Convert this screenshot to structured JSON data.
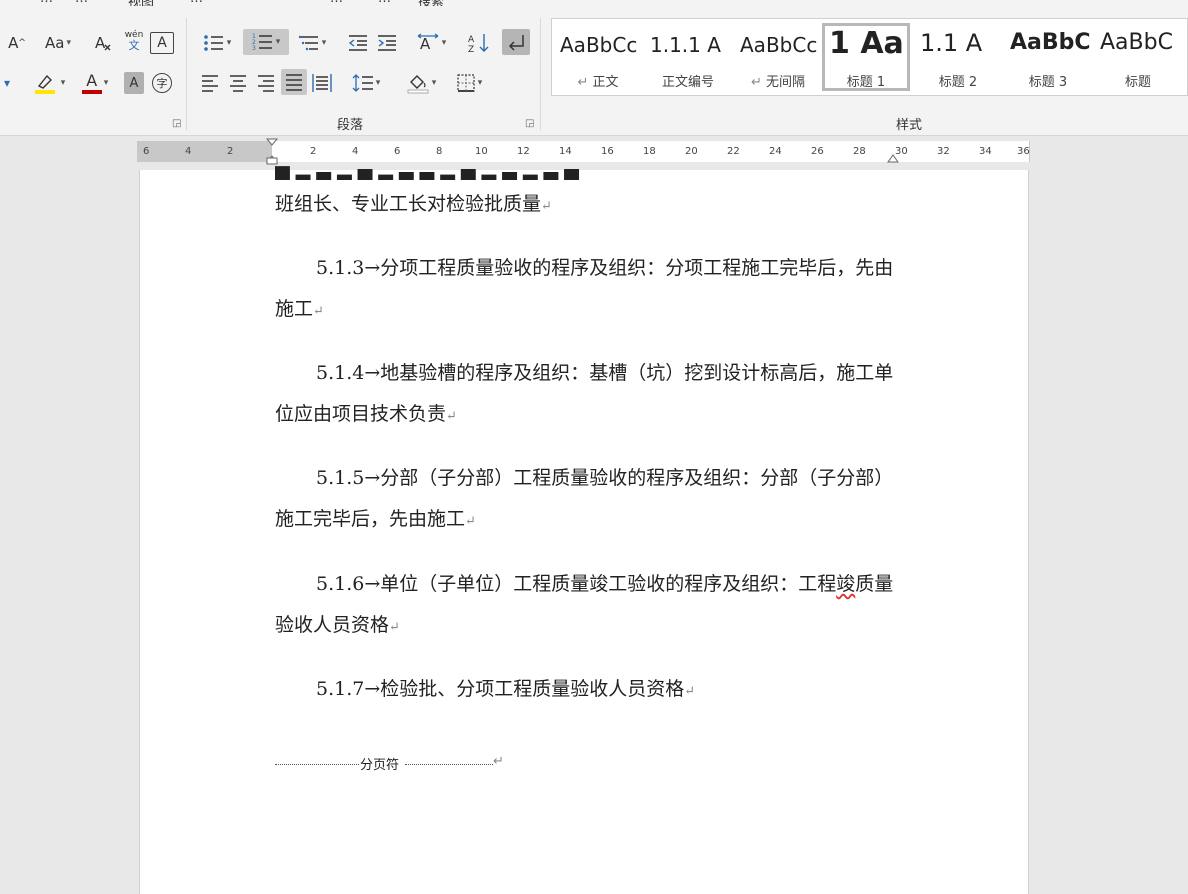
{
  "ribbon": {
    "partial_tabs": [
      "…",
      "…",
      "视图",
      "…",
      "…",
      "…",
      "搜索"
    ],
    "font_group": {
      "grow_font": "A",
      "change_case": "Aa",
      "phonetic_top": "wén",
      "phonetic_bottom": "文",
      "char_border": "A",
      "font_color": "A",
      "char_shading": "A",
      "enclose": "字"
    },
    "paragraph_group": {
      "label": "段落"
    },
    "styles_group": {
      "label": "样式",
      "items": [
        {
          "preview": "AaBbCc",
          "name": "正文",
          "mark": "↵"
        },
        {
          "preview": "1.1.1 A",
          "name": "正文编号",
          "mark": ""
        },
        {
          "preview": "AaBbCc",
          "name": "无间隔",
          "mark": "↵"
        },
        {
          "preview": "1 Aa",
          "name": "标题 1",
          "mark": ""
        },
        {
          "preview": "1.1 A",
          "name": "标题 2",
          "mark": ""
        },
        {
          "preview": "AaBbC",
          "name": "标题 3",
          "mark": ""
        },
        {
          "preview": "AaBbC",
          "name": "标题",
          "mark": ""
        }
      ]
    }
  },
  "ruler": {
    "labels": [
      "6",
      "4",
      "2",
      "2",
      "4",
      "6",
      "8",
      "10",
      "12",
      "14",
      "16",
      "18",
      "20",
      "22",
      "24",
      "26",
      "28",
      "30",
      "32",
      "34",
      "36"
    ]
  },
  "document": {
    "paragraphs": [
      {
        "text": "班组长、专业工长对检验批质量",
        "indent": false
      },
      {
        "text": "5.1.3→分项工程质量验收的程序及组织：分项工程施工完毕后，先由施工",
        "indent": true
      },
      {
        "text": "5.1.4→地基验槽的程序及组织：基槽（坑）挖到设计标高后，施工单位应由项目技术负责",
        "indent": true
      },
      {
        "text": "5.1.5→分部（子分部）工程质量验收的程序及组织：分部（子分部）施工完毕后，先由施工",
        "indent": true
      },
      {
        "text_before": "5.1.6→单位（子单位）工程质量竣工验收的程序及组织：工程",
        "text_squiggle": "竣",
        "text_after": "质量验收人员资格",
        "indent": true
      },
      {
        "text": "5.1.7→检验批、分项工程质量验收人员资格",
        "indent": true
      }
    ],
    "paragraph_mark": "↵",
    "page_break_label": "分页符"
  }
}
